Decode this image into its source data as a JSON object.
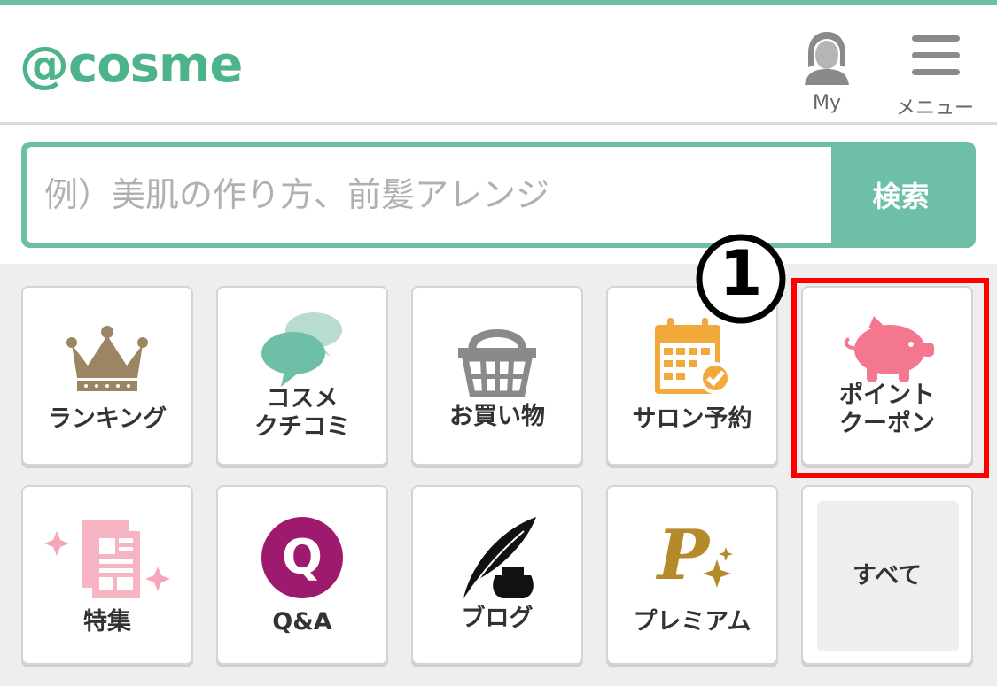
{
  "header": {
    "logo": "@cosme",
    "my_label": "My",
    "menu_label": "メニュー"
  },
  "search": {
    "placeholder": "例）美肌の作り方、前髪アレンジ",
    "button_label": "検索"
  },
  "annotation": {
    "marker": "1"
  },
  "categories": [
    {
      "label": "ランキング",
      "icon": "crown-icon"
    },
    {
      "label": "コスメ\nクチコミ",
      "icon": "speech-bubbles-icon"
    },
    {
      "label": "お買い物",
      "icon": "basket-icon"
    },
    {
      "label": "サロン予約",
      "icon": "calendar-icon"
    },
    {
      "label": "ポイント\nクーポン",
      "icon": "piggy-bank-icon"
    },
    {
      "label": "特集",
      "icon": "magazine-icon"
    },
    {
      "label": "Q&A",
      "icon": "qa-icon"
    },
    {
      "label": "ブログ",
      "icon": "quill-pen-icon"
    },
    {
      "label": "プレミアム",
      "icon": "premium-p-icon"
    },
    {
      "label": "すべて",
      "icon": ""
    }
  ],
  "colors": {
    "brand": "#4cb38a",
    "search_bar": "#6dbfa8",
    "highlight": "#ff0000"
  }
}
